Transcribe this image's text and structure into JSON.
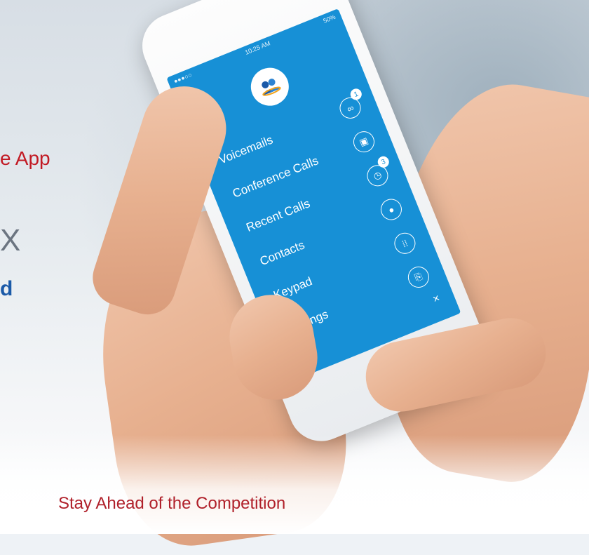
{
  "hero": {
    "line1": "e App",
    "line2": "X",
    "line3": "d"
  },
  "tagline": "Stay Ahead of the Competition",
  "phone": {
    "status": {
      "left": "●●●○○",
      "time": "10:25 AM",
      "battery": "50%"
    },
    "menu": [
      {
        "label": "Voicemails",
        "icon": "voicemail-icon",
        "badge": "1"
      },
      {
        "label": "Conference Calls",
        "icon": "calendar-icon",
        "badge": ""
      },
      {
        "label": "Recent Calls",
        "icon": "clock-icon",
        "badge": "3"
      },
      {
        "label": "Contacts",
        "icon": "person-icon",
        "badge": ""
      },
      {
        "label": "Keypad",
        "icon": "keypad-icon",
        "badge": ""
      },
      {
        "label": "Settings",
        "icon": "settings-icon",
        "badge": ""
      }
    ],
    "close": "×"
  },
  "colors": {
    "screen": "#1790d6",
    "accent_red": "#c21a24",
    "accent_blue": "#1b5aa8"
  }
}
